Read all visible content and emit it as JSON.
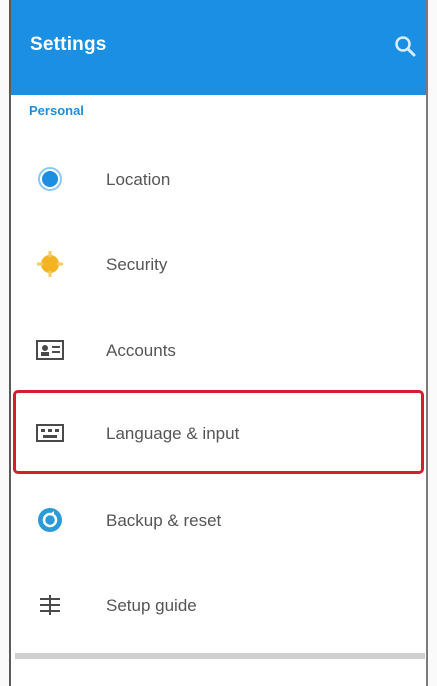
{
  "app": {
    "title": "Settings"
  },
  "section": {
    "label": "Personal"
  },
  "items": [
    {
      "label": "Location",
      "icon": "location-icon",
      "color": "#1a8fe3"
    },
    {
      "label": "Security",
      "icon": "security-icon",
      "color": "#f3b322"
    },
    {
      "label": "Accounts",
      "icon": "accounts-icon",
      "color": "#4a4a4a"
    },
    {
      "label": "Language & input",
      "icon": "language-icon",
      "color": "#4a4a4a"
    },
    {
      "label": "Backup & reset",
      "icon": "backup-icon",
      "color": "#2b9ad6"
    },
    {
      "label": "Setup guide",
      "icon": "setup-guide-icon",
      "color": "#4a4a4a"
    }
  ],
  "colors": {
    "accent": "#1a8fe3",
    "highlight": "#d31f2b"
  }
}
